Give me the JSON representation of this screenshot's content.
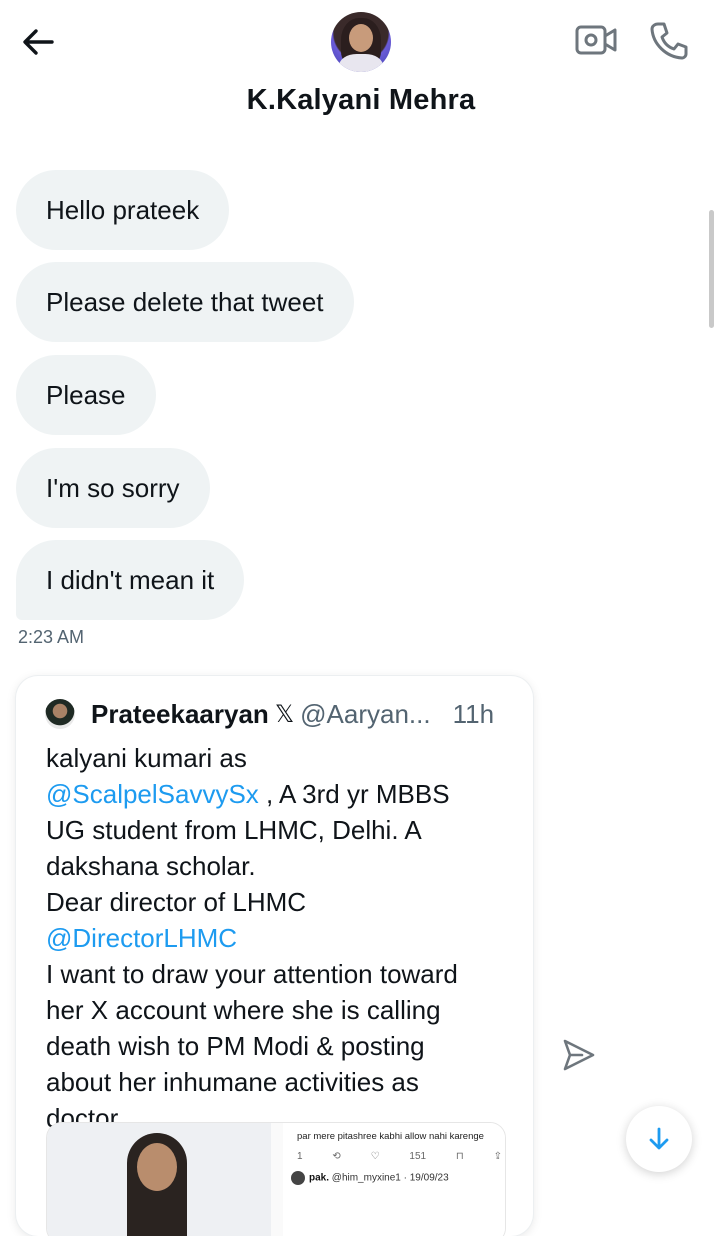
{
  "header": {
    "contact_name": "K.Kalyani Mehra",
    "icons": {
      "back": "back-arrow-icon",
      "video": "video-camera-icon",
      "call": "phone-icon"
    }
  },
  "messages": [
    {
      "text": "Hello prateek"
    },
    {
      "text": "Please delete that tweet"
    },
    {
      "text": "Please"
    },
    {
      "text": "I'm so sorry"
    },
    {
      "text": "I didn't mean it"
    }
  ],
  "timestamp": "2:23 AM",
  "shared_tweet": {
    "author_name": "Prateekaaryan",
    "verified_mark": "𝕏",
    "handle": "@Aaryan...",
    "time_ago": "11h",
    "text_lines": [
      "kalyani kumari as",
      "@ScalpelSavvySx",
      " , A 3rd yr MBBS",
      "UG student from LHMC, Delhi. A",
      "dakshana scholar.",
      "Dear director of LHMC",
      "@DirectorLHMC",
      "I want to draw your attention toward",
      "her X account where she is calling",
      "death wish to PM Modi & posting",
      "about  her inhumane activities as",
      "doctor"
    ],
    "media": {
      "quoted_text": "par mere pitashree kabhi allow nahi karenge",
      "stats": [
        "1",
        "⟲",
        "♡",
        "151",
        "⊓",
        "⇪"
      ],
      "reply_user": "pak.",
      "reply_handle": "@him_myxine1 · 19/09/23"
    }
  },
  "colors": {
    "bubble": "#eff3f4",
    "mention": "#1d9bf0",
    "muted": "#536471"
  }
}
